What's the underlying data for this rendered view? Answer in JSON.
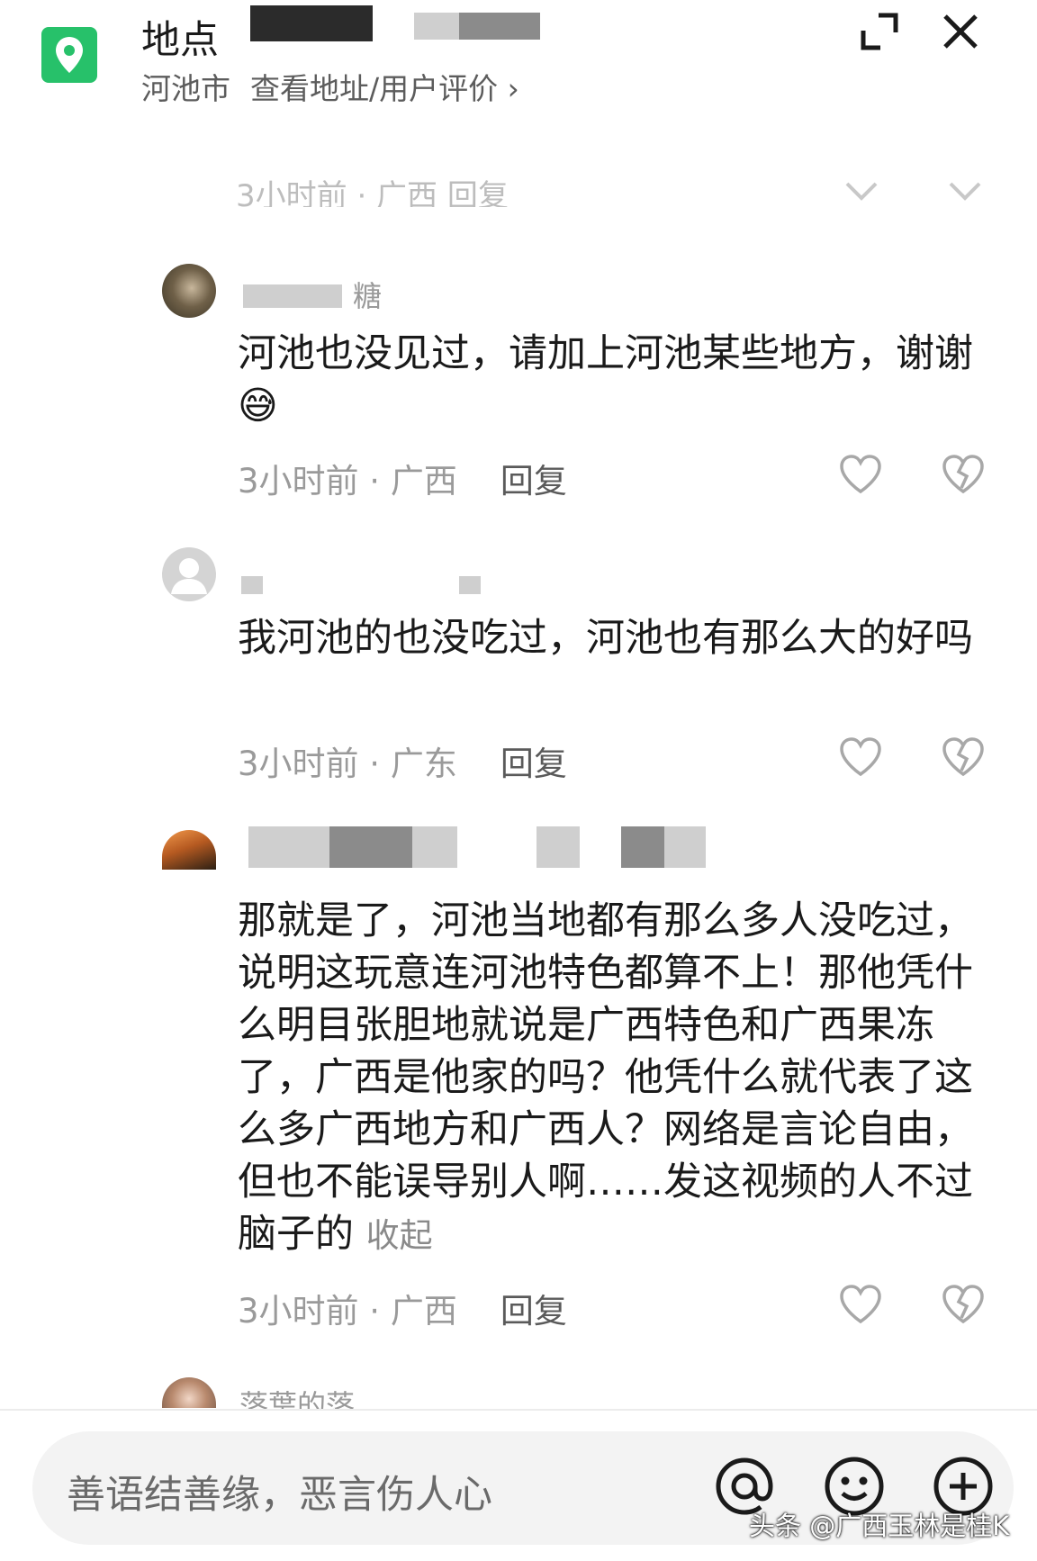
{
  "header": {
    "title": "地点",
    "city": "河池市",
    "address_link": "查看地址/用户评价 ›"
  },
  "ghost_row": {
    "text": "3小时前 · 广西  回复"
  },
  "comments": [
    {
      "username": "糖",
      "text": "河池也没见过，请加上河池某些地方，谢谢😅",
      "time": "3小时前",
      "region": "广西",
      "reply": "回复"
    },
    {
      "username": "",
      "text": "我河池的也没吃过，河池也有那么大的好吗",
      "time": "3小时前",
      "region": "广东",
      "reply": "回复"
    },
    {
      "username": "",
      "text": "那就是了，河池当地都有那么多人没吃过，说明这玩意连河池特色都算不上！那他凭什么明目张胆地就说是广西特色和广西果冻了，广西是他家的吗？他凭什么就代表了这么多广西地方和广西人？网络是言论自由，但也不能误导别人啊……发这视频的人不过脑子的",
      "collapse": "收起",
      "time": "3小时前",
      "region": "广西",
      "reply": "回复"
    },
    {
      "username": "落葉的落"
    }
  ],
  "input": {
    "placeholder": "善语结善缘，恶言伤人心"
  },
  "watermark": "头条 @广西玉林是桂K",
  "colors": {
    "brand_green": "#27c16a",
    "meta_gray": "#9a9a9a",
    "text": "#1a1a1a",
    "input_bg": "#f3f3f3"
  },
  "icons": [
    "location-pin-icon",
    "expand-icon",
    "close-icon",
    "heart-icon",
    "broken-heart-icon",
    "at-icon",
    "emoji-icon",
    "plus-icon"
  ]
}
